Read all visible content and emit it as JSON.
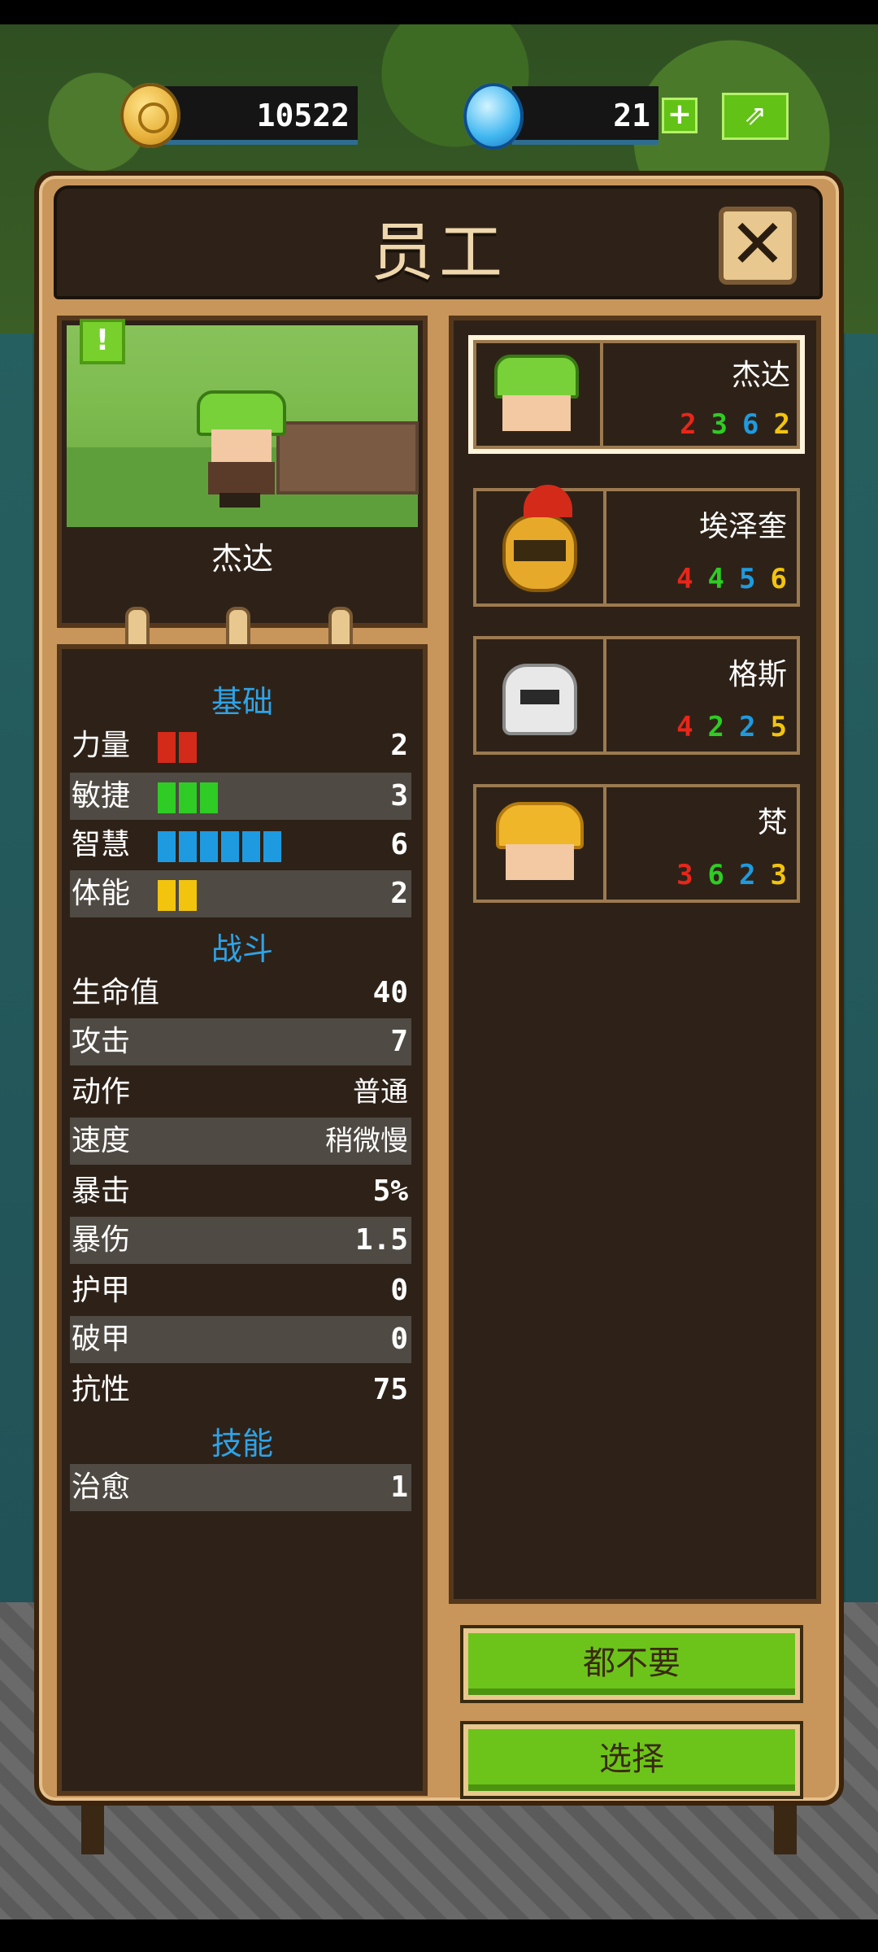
{
  "currency": {
    "gold": "10522",
    "gems": "21",
    "plus_label": "+",
    "share_label": "⇗"
  },
  "dialog": {
    "title": "员工",
    "close_label": "✕",
    "alert_label": "!"
  },
  "selected": {
    "name": "杰达"
  },
  "stats": {
    "section_basic": "基础",
    "strength": {
      "label": "力量",
      "value": "2",
      "bars": 2,
      "color": "#d42a1a"
    },
    "agility": {
      "label": "敏捷",
      "value": "3",
      "bars": 3,
      "color": "#2ecc24"
    },
    "wisdom": {
      "label": "智慧",
      "value": "6",
      "bars": 6,
      "color": "#1e9be0"
    },
    "stamina": {
      "label": "体能",
      "value": "2",
      "bars": 2,
      "color": "#f2c40e"
    },
    "section_combat": "战斗",
    "hp": {
      "label": "生命值",
      "value": "40"
    },
    "attack": {
      "label": "攻击",
      "value": "7"
    },
    "action": {
      "label": "动作",
      "value": "普通"
    },
    "speed": {
      "label": "速度",
      "value": "稍微慢"
    },
    "crit": {
      "label": "暴击",
      "value": "5%"
    },
    "crit_dmg": {
      "label": "暴伤",
      "value": "1.5"
    },
    "armor": {
      "label": "护甲",
      "value": "0"
    },
    "armor_pen": {
      "label": "破甲",
      "value": "0"
    },
    "resist": {
      "label": "抗性",
      "value": "75"
    },
    "section_skill": "技能",
    "heal": {
      "label": "治愈",
      "value": "1"
    }
  },
  "roster": [
    {
      "name": "杰达",
      "stats": [
        "2",
        "3",
        "6",
        "2"
      ]
    },
    {
      "name": "埃泽奎",
      "stats": [
        "4",
        "4",
        "5",
        "6"
      ]
    },
    {
      "name": "格斯",
      "stats": [
        "4",
        "2",
        "2",
        "5"
      ]
    },
    {
      "name": "梵",
      "stats": [
        "3",
        "6",
        "2",
        "3"
      ]
    }
  ],
  "stat_colors": [
    "#e8261a",
    "#2ecc24",
    "#1e9be0",
    "#f2c40e"
  ],
  "buttons": {
    "none_label": "都不要",
    "select_label": "选择"
  }
}
